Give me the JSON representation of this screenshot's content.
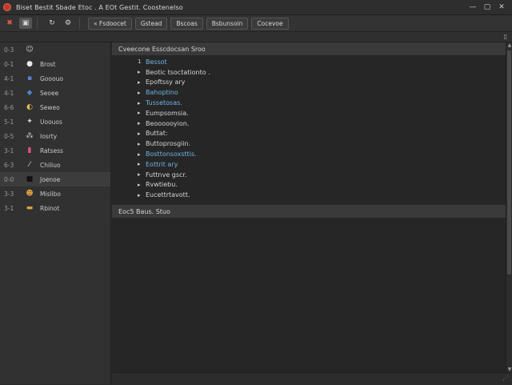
{
  "window": {
    "title": "Biset  Bestit Sbade  Etoc . A  EOt  Gestit.  Coostenelso"
  },
  "titlebar_controls": {
    "minimize": "—",
    "maximize": "▢",
    "close": "✕"
  },
  "toolbar": {
    "buttons": [
      "« Fsdoocet",
      "Gstead",
      "Bscoas",
      "Bsbunsoin",
      "Cocevoe"
    ]
  },
  "subbar": {
    "right_glyph": "▯"
  },
  "sidebar": {
    "items": [
      {
        "num": "0-3",
        "icon": "☺",
        "label": "",
        "icon_color": "#cfcfcf"
      },
      {
        "num": "0-1",
        "icon": "●",
        "label": "Brost",
        "icon_color": "#e8e8e8"
      },
      {
        "num": "4-1",
        "icon": "▪",
        "label": "Gooouo",
        "icon_color": "#5b7fd0"
      },
      {
        "num": "4-1",
        "icon": "◆",
        "label": "Seoee",
        "icon_color": "#4a86c8"
      },
      {
        "num": "6-6",
        "icon": "◐",
        "label": "Seweo",
        "icon_color": "#e0c04a"
      },
      {
        "num": "5-1",
        "icon": "✦",
        "label": "Uoouos",
        "icon_color": "#d8d8d8"
      },
      {
        "num": "0-5",
        "icon": "⁂",
        "label": "Iosrty",
        "icon_color": "#d8d8d8"
      },
      {
        "num": "3-1",
        "icon": "▮",
        "label": "Ratsess",
        "icon_color": "#e8547a"
      },
      {
        "num": "6-3",
        "icon": "⁄",
        "label": "Chiliuo",
        "icon_color": "#cfcfcf"
      },
      {
        "num": "0-0",
        "icon": "■",
        "label": "Joenoe",
        "icon_color": "#111111"
      },
      {
        "num": "3-3",
        "icon": "☻",
        "label": "Mislibo",
        "icon_color": "#e0a040"
      },
      {
        "num": "3-1",
        "icon": "▬",
        "label": "Rbinot",
        "icon_color": "#e0a040"
      }
    ],
    "selected_index": 9
  },
  "main": {
    "section_top": "Cveecone  Esscdocsan  Sroo",
    "tree": [
      {
        "arrow": "1",
        "label": "Bessot",
        "blue": true
      },
      {
        "arrow": "▸",
        "label": "Beotic tsoctationto .",
        "blue": false
      },
      {
        "arrow": "▸",
        "label": "Epoftssy ary",
        "blue": false
      },
      {
        "arrow": "▸",
        "label": "Bahoptino",
        "blue": true
      },
      {
        "arrow": "▸",
        "label": "Tussetosas.",
        "blue": true
      },
      {
        "arrow": "▸",
        "label": "Eumpsomsia.",
        "blue": false
      },
      {
        "arrow": "▸",
        "label": "Beoooooyion.",
        "blue": false
      },
      {
        "arrow": "▸",
        "label": "Buttat:",
        "blue": false
      },
      {
        "arrow": "▸",
        "label": "Buttoprosgiin.",
        "blue": false
      },
      {
        "arrow": "▸",
        "label": "Bosttonsoxsttis.",
        "blue": true
      },
      {
        "arrow": "▸",
        "label": "Eottrit ary",
        "blue": true
      },
      {
        "arrow": "▸",
        "label": "Futtnve gscr.",
        "blue": false
      },
      {
        "arrow": "▸",
        "label": "Rvwtiebu.",
        "blue": false
      },
      {
        "arrow": "▸",
        "label": "Eucettrtavott.",
        "blue": false
      }
    ],
    "section_bottom": "Eoc5 Baus. Stuo"
  },
  "scrollbar": {
    "up": "▲",
    "down": "▼"
  },
  "statusbar": {
    "grip": "⋰"
  }
}
